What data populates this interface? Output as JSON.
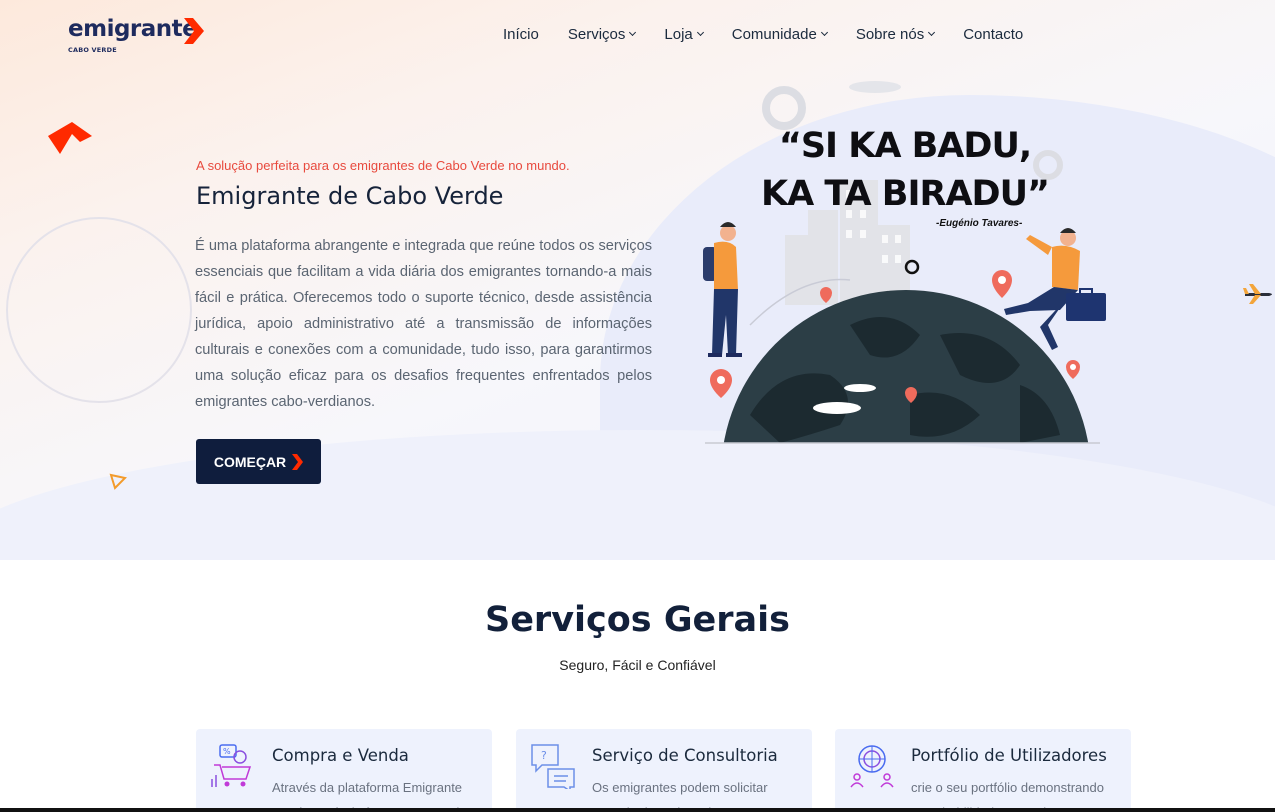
{
  "brand": {
    "name": "emigrante",
    "sub": "CABO VERDE",
    "accent": "#ff2a00",
    "dark": "#0f1d3d"
  },
  "nav": {
    "items": [
      {
        "label": "Início",
        "dropdown": false
      },
      {
        "label": "Serviços",
        "dropdown": true
      },
      {
        "label": "Loja",
        "dropdown": true
      },
      {
        "label": "Comunidade",
        "dropdown": true
      },
      {
        "label": "Sobre nós",
        "dropdown": true
      },
      {
        "label": "Contacto",
        "dropdown": false
      }
    ]
  },
  "hero": {
    "tagline": "A solução perfeita para os emigrantes de Cabo Verde no mundo.",
    "title": "Emigrante de Cabo Verde",
    "description": "É uma plataforma abrangente e integrada que reúne todos os serviços essenciais que facilitam a vida diária dos emigrantes tornando-a mais fácil e prática. Oferecemos todo o suporte técnico, desde assistência jurídica, apoio administrativo até a transmissão de informações culturais e conexões com a comunidade, tudo isso, para garantirmos uma solução eficaz para os desafios frequentes enfrentados pelos emigrantes cabo-verdianos.",
    "cta_label": "COMEÇAR",
    "quote_line1": "“SI KA BADU,",
    "quote_line2": "KA TA BIRADU”",
    "quote_author": "-Eugénio Tavares-"
  },
  "services": {
    "title": "Serviços Gerais",
    "subtitle": "Seguro, Fácil e Confiável",
    "cards": [
      {
        "title": "Compra e Venda",
        "text": "Através da plataforma Emigrante CV, é possível efectuar a troca de",
        "icon": "shopping-cart-icon"
      },
      {
        "title": "Serviço de Consultoria",
        "text": "Os emigrantes podem solicitar consultoria onde estiverem e",
        "icon": "chat-question-icon"
      },
      {
        "title": "Portfólio de Utilizadores",
        "text": "crie o seu portfólio demonstrando suas habilidades e venha prestar o",
        "icon": "users-globe-icon"
      }
    ]
  }
}
